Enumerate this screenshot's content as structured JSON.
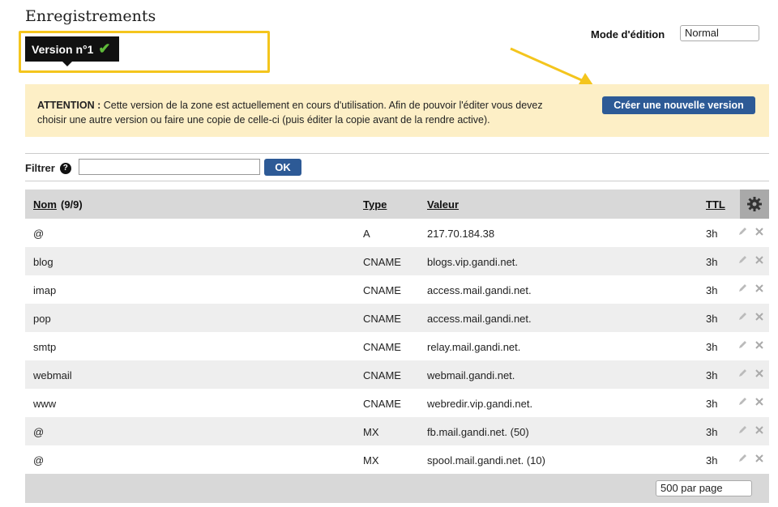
{
  "page": {
    "title": "Enregistrements",
    "version_badge": "Version n°1",
    "mode_label": "Mode d'édition",
    "mode_value": "Normal"
  },
  "warning": {
    "label": "ATTENTION :",
    "text_line1": "Cette version de la zone est actuellement en cours d'utilisation. Afin de pouvoir l'éditer vous devez",
    "text_line2": "choisir une autre version ou faire une copie de celle-ci (puis éditer la copie avant de la rendre active).",
    "create_button": "Créer une nouvelle version"
  },
  "filter": {
    "label": "Filtrer",
    "input_value": "",
    "ok_button": "OK"
  },
  "table": {
    "headers": {
      "name": "Nom",
      "name_count": "(9/9)",
      "type": "Type",
      "value": "Valeur",
      "ttl": "TTL"
    },
    "rows": [
      {
        "name": "@",
        "type": "A",
        "value": "217.70.184.38",
        "ttl": "3h"
      },
      {
        "name": "blog",
        "type": "CNAME",
        "value": "blogs.vip.gandi.net.",
        "ttl": "3h"
      },
      {
        "name": "imap",
        "type": "CNAME",
        "value": "access.mail.gandi.net.",
        "ttl": "3h"
      },
      {
        "name": "pop",
        "type": "CNAME",
        "value": "access.mail.gandi.net.",
        "ttl": "3h"
      },
      {
        "name": "smtp",
        "type": "CNAME",
        "value": "relay.mail.gandi.net.",
        "ttl": "3h"
      },
      {
        "name": "webmail",
        "type": "CNAME",
        "value": "webmail.gandi.net.",
        "ttl": "3h"
      },
      {
        "name": "www",
        "type": "CNAME",
        "value": "webredir.vip.gandi.net.",
        "ttl": "3h"
      },
      {
        "name": "@",
        "type": "MX",
        "value": "fb.mail.gandi.net. (50)",
        "ttl": "3h"
      },
      {
        "name": "@",
        "type": "MX",
        "value": "spool.mail.gandi.net. (10)",
        "ttl": "3h"
      }
    ],
    "per_page": "500 par page"
  },
  "colors": {
    "accent_button": "#2d5a96",
    "highlight": "#f4c51d",
    "warning_bg": "#fdefc6"
  },
  "icons": {
    "check": "check-icon",
    "help": "help-icon",
    "settings": "gear-icon",
    "edit": "pencil-icon",
    "delete": "close-icon"
  }
}
